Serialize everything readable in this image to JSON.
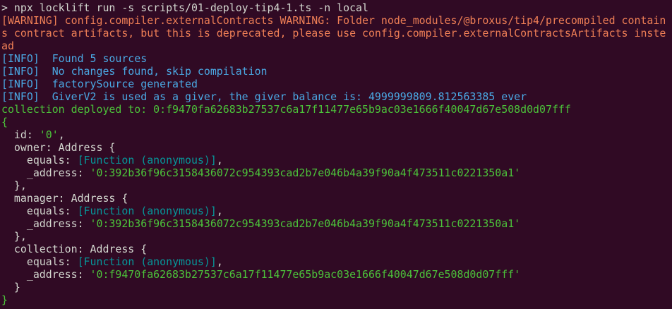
{
  "colors": {
    "background": "#300a24",
    "foreground": "#d3d7cf",
    "warning": "#ef7f56",
    "info": "#4aa8e3",
    "success": "#4cc33a",
    "function": "#06989a"
  },
  "command": "> npx locklift run -s scripts/01-deploy-tip4-1.ts -n local",
  "warning": "[WARNING]  config.compiler.externalContracts WARNING: Folder node_modules/@broxus/tip4/precompiled contains contract artifacts, but this is deprecated, please use config.compiler.externalContractsArtifacts instead",
  "info_lines": [
    "[INFO]  Found 5 sources",
    "[INFO]  No changes found, skip compilation",
    "[INFO]  factorySource generated",
    "[INFO]  GiverV2 is used as a giver, the giver balance is: 4999999809.812563385 ever"
  ],
  "deployed": "collection deployed to: 0:f9470fa62683b27537c6a17f11477e65b9ac03e1666f40047d67e508d0d07fff",
  "object": {
    "open": "{",
    "id_key": "  id: ",
    "id_value": "'0'",
    "id_comma": ",",
    "owner_key": "  owner: Address {",
    "owner_equals_key": "    equals: ",
    "owner_equals_value": "[Function (anonymous)]",
    "owner_equals_comma": ",",
    "owner_address_key": "    _address: ",
    "owner_address_value": "'0:392b36f96c3158436072c954393cad2b7e046b4a39f90a4f473511c0221350a1'",
    "owner_close": "  },",
    "manager_key": "  manager: Address {",
    "manager_equals_key": "    equals: ",
    "manager_equals_value": "[Function (anonymous)]",
    "manager_equals_comma": ",",
    "manager_address_key": "    _address: ",
    "manager_address_value": "'0:392b36f96c3158436072c954393cad2b7e046b4a39f90a4f473511c0221350a1'",
    "manager_close": "  },",
    "collection_key": "  collection: Address {",
    "collection_equals_key": "    equals: ",
    "collection_equals_value": "[Function (anonymous)]",
    "collection_equals_comma": ",",
    "collection_address_key": "    _address: ",
    "collection_address_value": "'0:f9470fa62683b27537c6a17f11477e65b9ac03e1666f40047d67e508d0d07fff'",
    "collection_close": "  }",
    "close": "}"
  }
}
